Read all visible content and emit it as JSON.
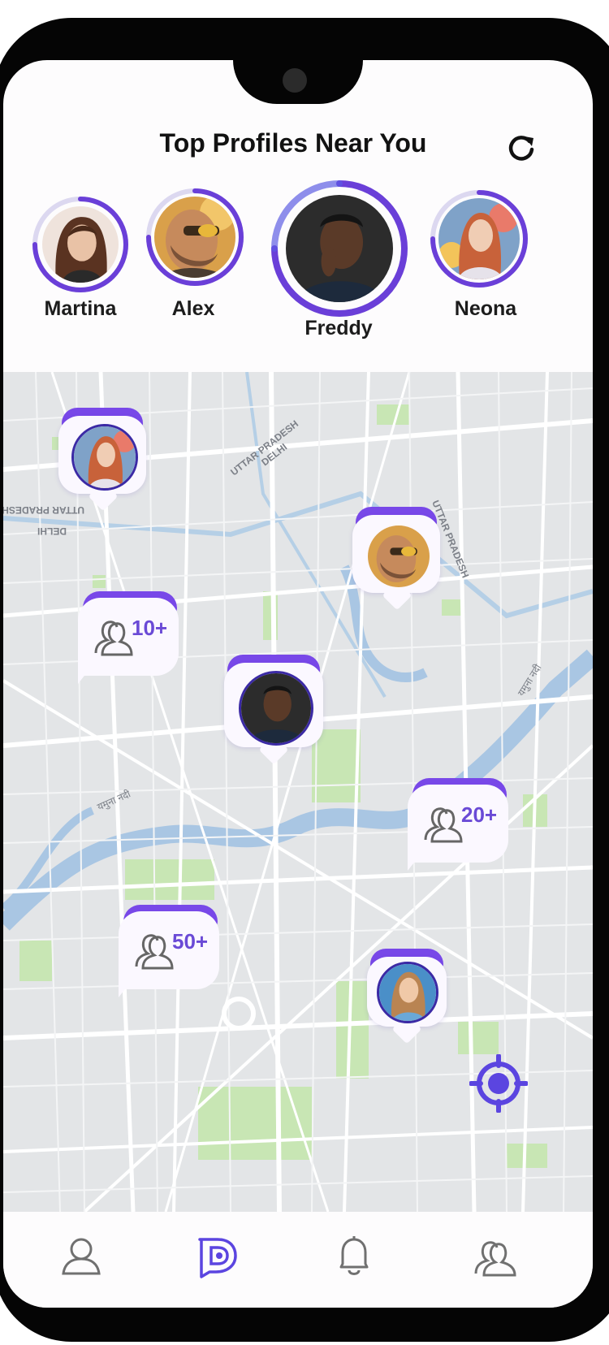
{
  "header": {
    "title": "Top Profiles Near You",
    "refresh_icon": "refresh-icon"
  },
  "top_profiles": [
    {
      "name": "Martina",
      "highlighted": false
    },
    {
      "name": "Alex",
      "highlighted": false
    },
    {
      "name": "Freddy",
      "highlighted": true
    },
    {
      "name": "Neona",
      "highlighted": false
    }
  ],
  "map": {
    "labels": [
      "UTTAR PRADESH",
      "DELHI",
      "UTTAR PRADESH",
      "DELHI",
      "UTTAR PRADESH",
      "यमुना नदी",
      "यमुना नदी"
    ],
    "group_pins": [
      {
        "count": "10+"
      },
      {
        "count": "20+"
      },
      {
        "count": "50+"
      }
    ],
    "locate_icon": "crosshair-icon"
  },
  "tabs": [
    {
      "icon": "user-icon",
      "active": false
    },
    {
      "icon": "chat-logo-icon",
      "active": true
    },
    {
      "icon": "bell-icon",
      "active": false
    },
    {
      "icon": "users-icon",
      "active": false
    }
  ],
  "colors": {
    "accent": "#6a4ad6",
    "accent_dark": "#3b2aa5",
    "map_bg": "#e3e5e7",
    "water": "#a9c6e3",
    "park": "#c8e6b4"
  }
}
